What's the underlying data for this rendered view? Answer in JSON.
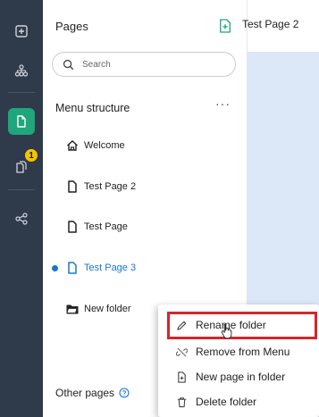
{
  "panel": {
    "title": "Pages",
    "search_placeholder": "Search",
    "section_title": "Menu structure",
    "more_label": "···",
    "tree": [
      {
        "label": "Welcome",
        "icon": "home-icon"
      },
      {
        "label": "Test Page 2",
        "icon": "page-icon"
      },
      {
        "label": "Test Page",
        "icon": "page-icon"
      },
      {
        "label": "Test Page 3",
        "icon": "page-icon",
        "active": true
      },
      {
        "label": "New folder",
        "icon": "folder-icon"
      }
    ],
    "other_pages_label": "Other pages"
  },
  "rail": {
    "notification_count": "1"
  },
  "editor": {
    "tab_title": "Test Page 2"
  },
  "context_menu": {
    "items": [
      {
        "label": "Rename folder",
        "icon": "pencil-icon"
      },
      {
        "label": "Remove from Menu",
        "icon": "unlink-icon"
      },
      {
        "label": "New page in folder",
        "icon": "new-page-icon"
      },
      {
        "label": "Delete folder",
        "icon": "trash-icon"
      }
    ]
  },
  "colors": {
    "rail_bg": "#2f3a4a",
    "rail_active": "#1fa67a",
    "badge": "#f5c400",
    "accent": "#1976d2",
    "highlight": "#d3262d",
    "canvas_bg": "#dce7f7"
  }
}
